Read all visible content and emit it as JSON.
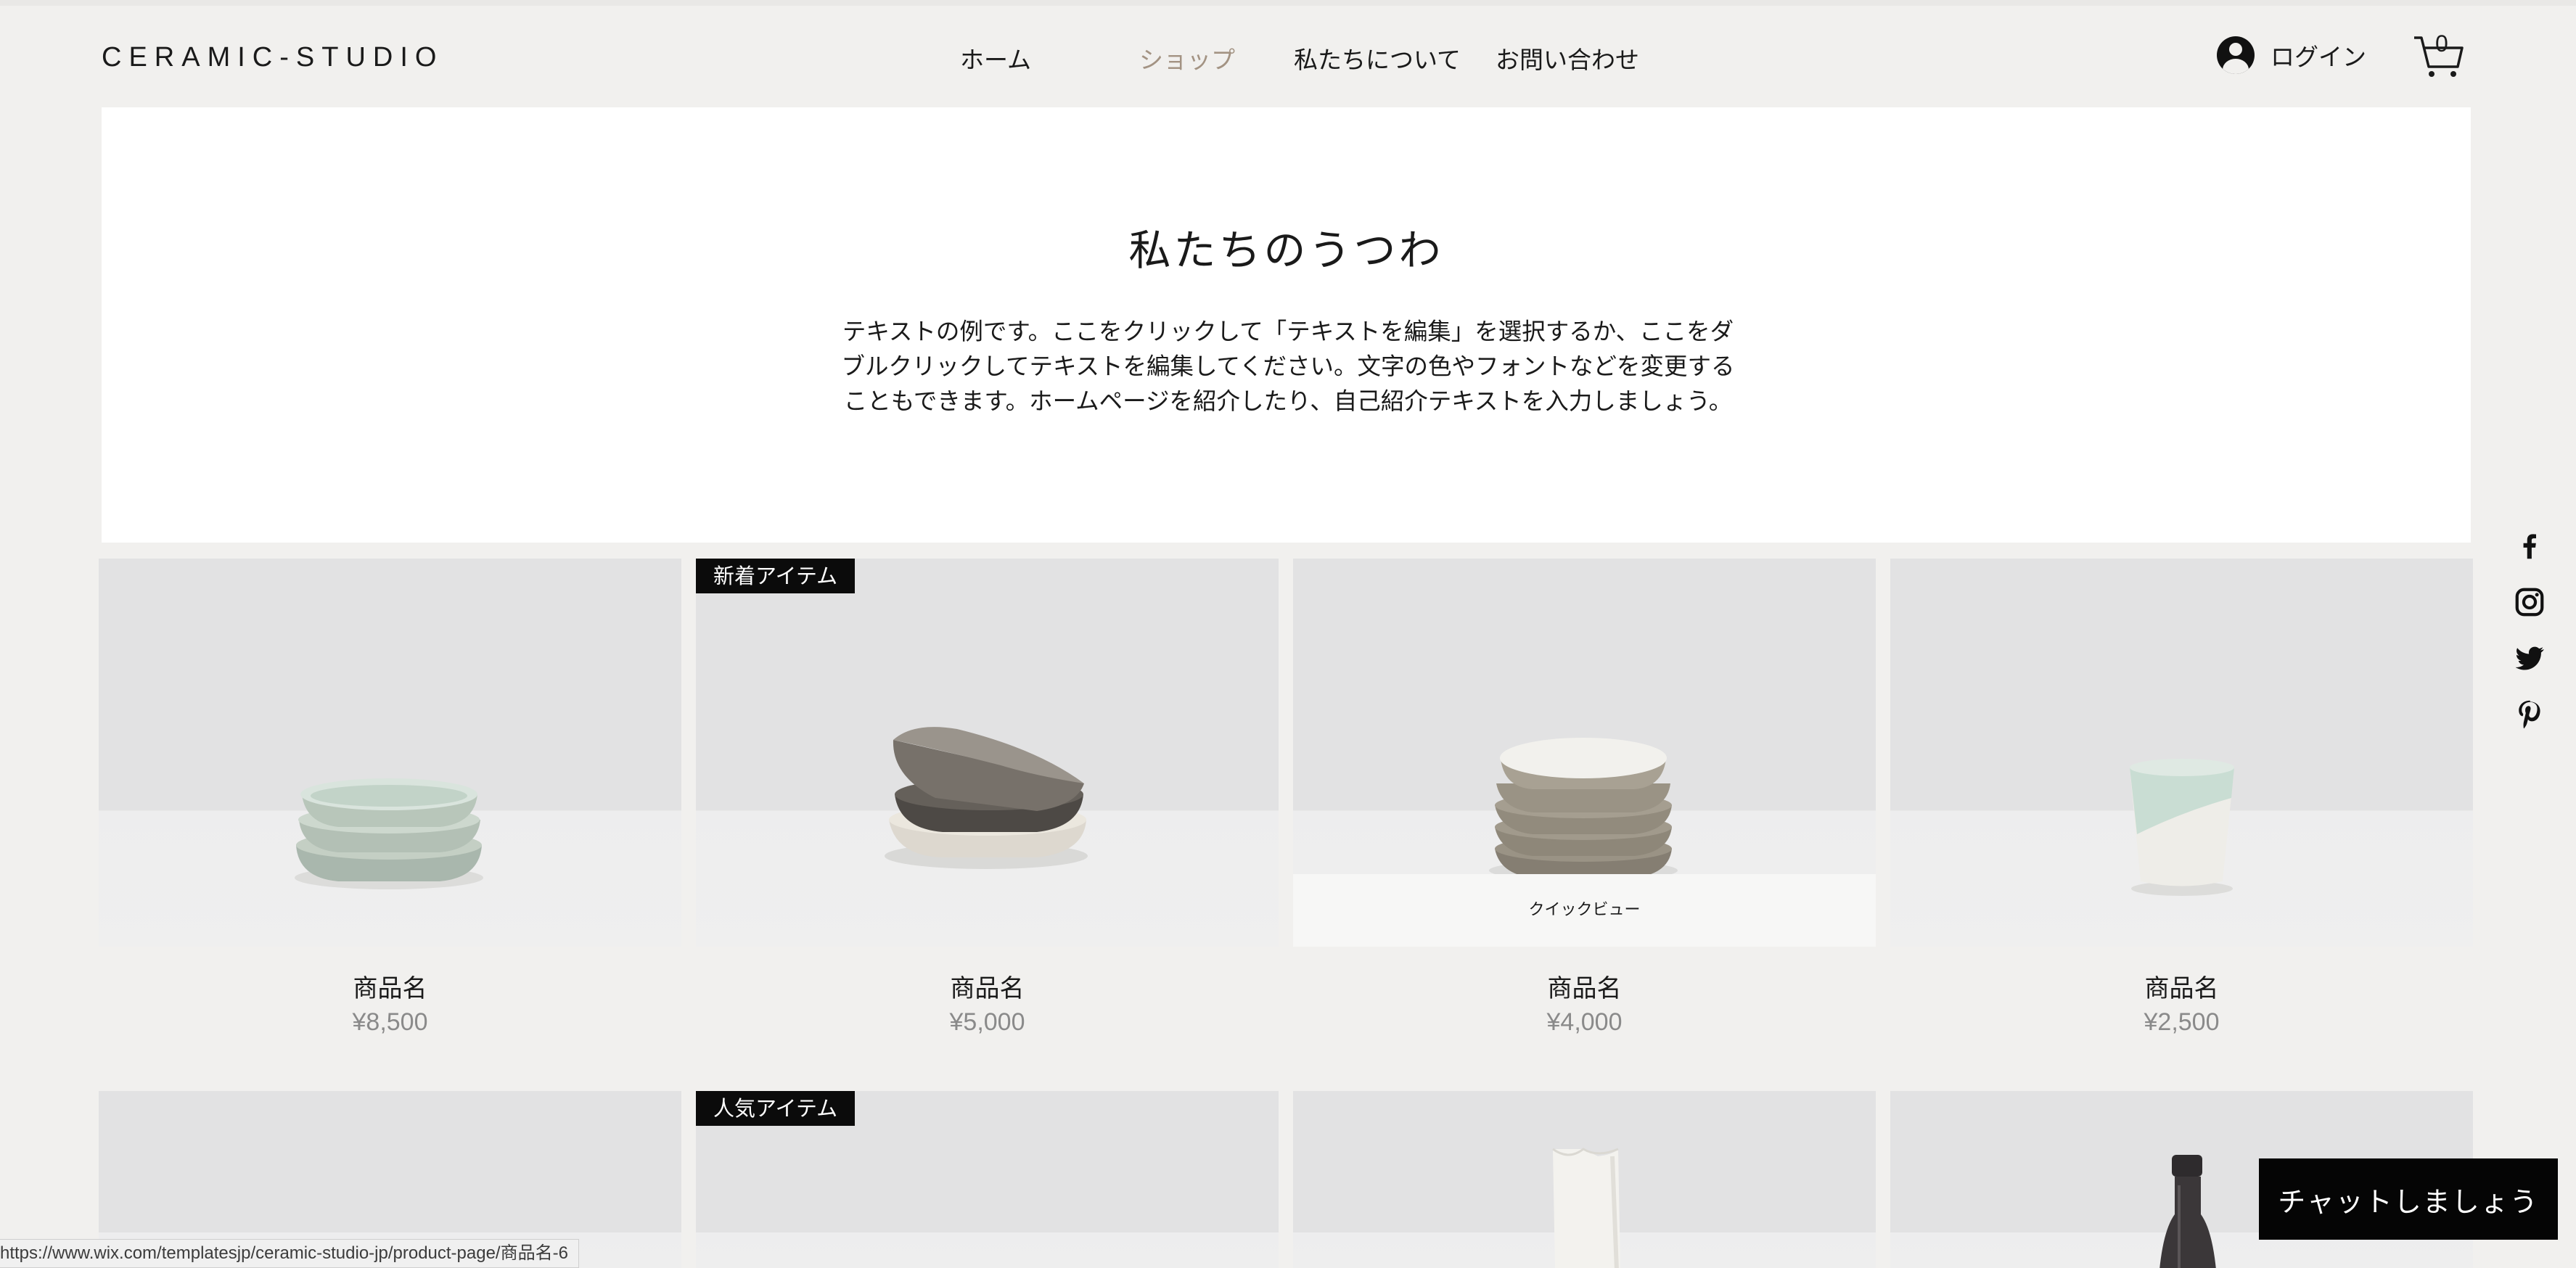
{
  "header": {
    "logo": "CERAMIC-STUDIO",
    "nav": [
      {
        "label": "ホーム",
        "active": false
      },
      {
        "label": "ショップ",
        "active": true
      },
      {
        "label": "私たちについて",
        "active": false
      },
      {
        "label": "お問い合わせ",
        "active": false
      }
    ],
    "login_label": "ログイン",
    "cart_count": "0",
    "active_color": "#a39383"
  },
  "intro": {
    "title": "私たちのうつわ",
    "text": "テキストの例です。ここをクリックして「テキストを編集」を選択するか、ここをダブルクリックしてテキストを編集してください。文字の色やフォントなどを変更することもできます。ホームページを紹介したり、自己紹介テキストを入力しましょう。"
  },
  "social": [
    "facebook-icon",
    "instagram-icon",
    "twitter-icon",
    "pinterest-icon"
  ],
  "products": [
    {
      "name": "商品名",
      "price": "¥8,500",
      "badge": "",
      "quick_view": "",
      "image": "stacked-celadon-bowls"
    },
    {
      "name": "商品名",
      "price": "¥5,000",
      "badge": "新着アイテム",
      "quick_view": "",
      "image": "stacked-grey-brown-bowls"
    },
    {
      "name": "商品名",
      "price": "¥4,000",
      "badge": "",
      "quick_view": "クイックビュー",
      "image": "stacked-stoneware-bowls"
    },
    {
      "name": "商品名",
      "price": "¥2,500",
      "badge": "",
      "quick_view": "",
      "image": "celadon-cup"
    },
    {
      "name": "",
      "price": "",
      "badge": "",
      "quick_view": "",
      "image": "blank"
    },
    {
      "name": "",
      "price": "",
      "badge": "人気アイテム",
      "quick_view": "",
      "image": "blank"
    },
    {
      "name": "",
      "price": "",
      "badge": "",
      "quick_view": "",
      "image": "white-pitcher"
    },
    {
      "name": "",
      "price": "",
      "badge": "",
      "quick_view": "",
      "image": "dark-bottle"
    }
  ],
  "chat_label": "チャットしましょう",
  "status_url": "https://www.wix.com/templatesjp/ceramic-studio-jp/product-page/商品名-6"
}
